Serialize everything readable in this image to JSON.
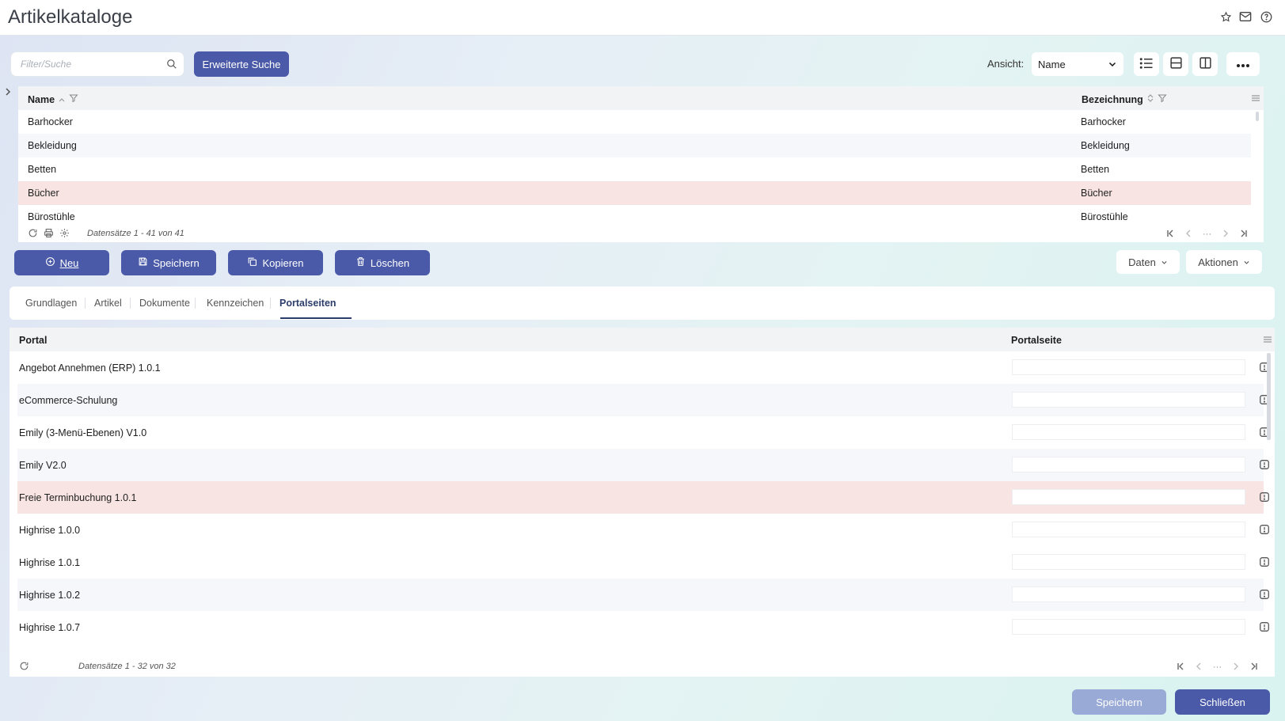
{
  "app": {
    "title": "Artikelkataloge",
    "header_icons": [
      "star-icon",
      "mail-icon",
      "help-icon"
    ]
  },
  "search": {
    "placeholder": "Filter/Suche",
    "value": "",
    "advanced_button": "Erweiterte Suche"
  },
  "view": {
    "label": "Ansicht:",
    "selected": "Name",
    "buttons": [
      "list-view-icon",
      "split-horizontal-icon",
      "split-vertical-icon",
      "more-icon"
    ]
  },
  "catalog_grid": {
    "columns": [
      "Name",
      "Bezeichnung"
    ],
    "rows": [
      {
        "name": "Barhocker",
        "bezeichnung": "Barhocker"
      },
      {
        "name": "Bekleidung",
        "bezeichnung": "Bekleidung"
      },
      {
        "name": "Betten",
        "bezeichnung": "Betten"
      },
      {
        "name": "Bücher",
        "bezeichnung": "Bücher"
      },
      {
        "name": "Bürostühle",
        "bezeichnung": "Bürostühle"
      }
    ],
    "selected_row": 3,
    "records_text": "Datensätze 1 - 41 von 41"
  },
  "actions": {
    "new": "Neu",
    "save": "Speichern",
    "copy": "Kopieren",
    "delete": "Löschen",
    "data": "Daten",
    "actions": "Aktionen"
  },
  "tabs": {
    "items": [
      "Grundlagen",
      "Artikel",
      "Dokumente",
      "Kennzeichen",
      "Portalseiten"
    ],
    "active": "Portalseiten"
  },
  "portal_grid": {
    "columns": [
      "Portal",
      "Portalseite"
    ],
    "rows": [
      {
        "portal": "Angebot Annehmen (ERP) 1.0.1",
        "portalseite": ""
      },
      {
        "portal": "eCommerce-Schulung",
        "portalseite": ""
      },
      {
        "portal": "Emily (3-Menü-Ebenen) V1.0",
        "portalseite": ""
      },
      {
        "portal": "Emily V2.0",
        "portalseite": ""
      },
      {
        "portal": "Freie Terminbuchung 1.0.1",
        "portalseite": ""
      },
      {
        "portal": "Highrise 1.0.0",
        "portalseite": ""
      },
      {
        "portal": "Highrise 1.0.1",
        "portalseite": ""
      },
      {
        "portal": "Highrise 1.0.2",
        "portalseite": ""
      },
      {
        "portal": "Highrise 1.0.7",
        "portalseite": ""
      }
    ],
    "selected_row": 4,
    "records_text": "Datensätze 1 - 32 von 32"
  },
  "footer": {
    "save": "Speichern",
    "close": "Schließen"
  },
  "colors": {
    "primary": "#4a5aa8",
    "selected_row": "#f8e5e3",
    "disabled_button": "#9aaad6"
  }
}
